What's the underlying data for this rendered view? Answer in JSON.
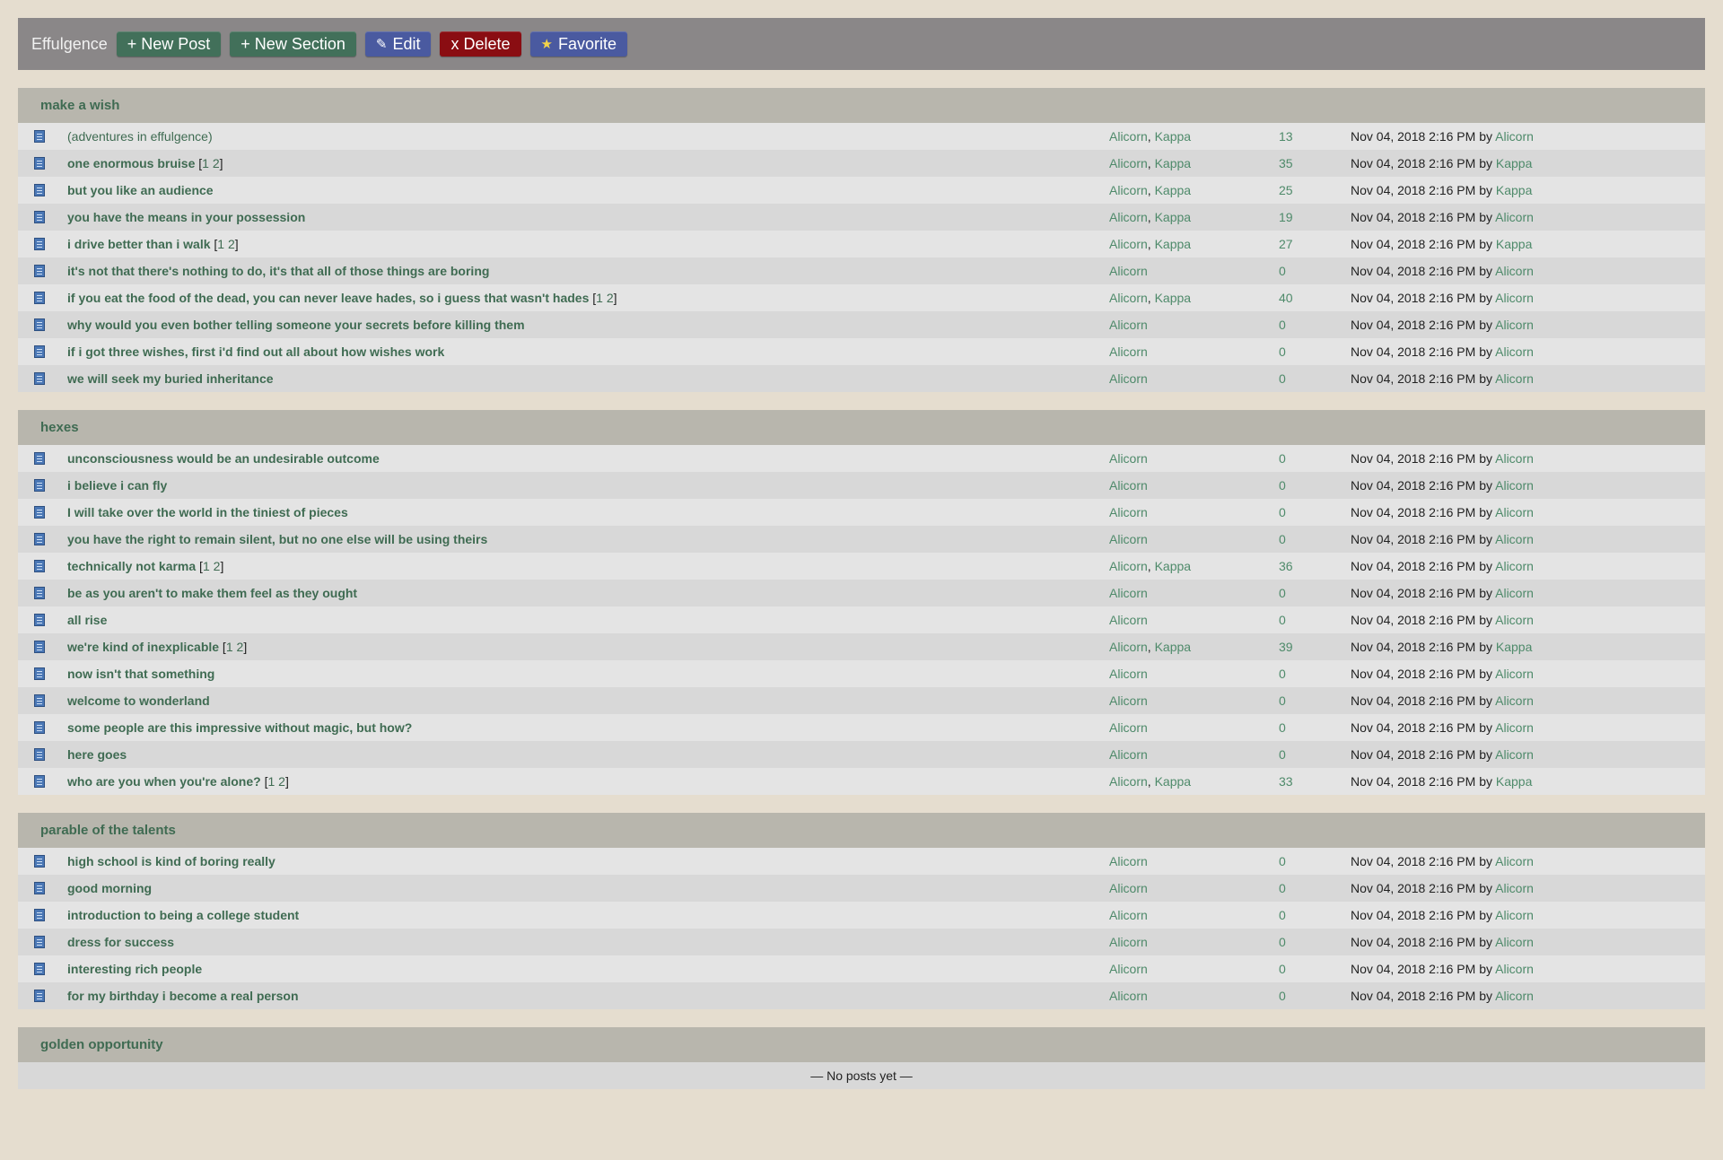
{
  "toolbar": {
    "app_title": "Effulgence",
    "buttons": [
      {
        "icon": "plus",
        "label": "+ New Post",
        "color": "#42705a"
      },
      {
        "icon": "plus",
        "label": "+ New Section",
        "color": "#42705a"
      },
      {
        "icon": "pencil-icon",
        "label": "Edit",
        "color": "#4a5aa0"
      },
      {
        "icon": "x",
        "label": "x Delete",
        "color": "#8a0d12"
      },
      {
        "icon": "star-icon",
        "label": "Favorite",
        "color": "#4a5aa0"
      }
    ]
  },
  "sections": [
    {
      "name": "make a wish",
      "posts": [
        {
          "title": "(adventures in effulgence)",
          "desc": true,
          "pages": [],
          "authors": [
            "Alicorn",
            "Kappa"
          ],
          "count": "13",
          "date": "Nov 04, 2018 2:16 PM",
          "by": "Alicorn"
        },
        {
          "title": "one enormous bruise",
          "pages": [
            "1",
            "2"
          ],
          "authors": [
            "Alicorn",
            "Kappa"
          ],
          "count": "35",
          "date": "Nov 04, 2018 2:16 PM",
          "by": "Kappa"
        },
        {
          "title": "but you like an audience",
          "pages": [],
          "authors": [
            "Alicorn",
            "Kappa"
          ],
          "count": "25",
          "date": "Nov 04, 2018 2:16 PM",
          "by": "Kappa"
        },
        {
          "title": "you have the means in your possession",
          "pages": [],
          "authors": [
            "Alicorn",
            "Kappa"
          ],
          "count": "19",
          "date": "Nov 04, 2018 2:16 PM",
          "by": "Alicorn"
        },
        {
          "title": "i drive better than i walk",
          "pages": [
            "1",
            "2"
          ],
          "authors": [
            "Alicorn",
            "Kappa"
          ],
          "count": "27",
          "date": "Nov 04, 2018 2:16 PM",
          "by": "Kappa"
        },
        {
          "title": "it's not that there's nothing to do, it's that all of those things are boring",
          "pages": [],
          "authors": [
            "Alicorn"
          ],
          "count": "0",
          "date": "Nov 04, 2018 2:16 PM",
          "by": "Alicorn"
        },
        {
          "title": "if you eat the food of the dead, you can never leave hades, so i guess that wasn't hades",
          "pages": [
            "1",
            "2"
          ],
          "authors": [
            "Alicorn",
            "Kappa"
          ],
          "count": "40",
          "date": "Nov 04, 2018 2:16 PM",
          "by": "Alicorn"
        },
        {
          "title": "why would you even bother telling someone your secrets before killing them",
          "pages": [],
          "authors": [
            "Alicorn"
          ],
          "count": "0",
          "date": "Nov 04, 2018 2:16 PM",
          "by": "Alicorn"
        },
        {
          "title": "if i got three wishes, first i'd find out all about how wishes work",
          "pages": [],
          "authors": [
            "Alicorn"
          ],
          "count": "0",
          "date": "Nov 04, 2018 2:16 PM",
          "by": "Alicorn"
        },
        {
          "title": "we will seek my buried inheritance",
          "pages": [],
          "authors": [
            "Alicorn"
          ],
          "count": "0",
          "date": "Nov 04, 2018 2:16 PM",
          "by": "Alicorn"
        }
      ]
    },
    {
      "name": "hexes",
      "posts": [
        {
          "title": "unconsciousness would be an undesirable outcome",
          "pages": [],
          "authors": [
            "Alicorn"
          ],
          "count": "0",
          "date": "Nov 04, 2018 2:16 PM",
          "by": "Alicorn"
        },
        {
          "title": "i believe i can fly",
          "pages": [],
          "authors": [
            "Alicorn"
          ],
          "count": "0",
          "date": "Nov 04, 2018 2:16 PM",
          "by": "Alicorn"
        },
        {
          "title": "I will take over the world in the tiniest of pieces",
          "pages": [],
          "authors": [
            "Alicorn"
          ],
          "count": "0",
          "date": "Nov 04, 2018 2:16 PM",
          "by": "Alicorn"
        },
        {
          "title": "you have the right to remain silent, but no one else will be using theirs",
          "pages": [],
          "authors": [
            "Alicorn"
          ],
          "count": "0",
          "date": "Nov 04, 2018 2:16 PM",
          "by": "Alicorn"
        },
        {
          "title": "technically not karma",
          "pages": [
            "1",
            "2"
          ],
          "authors": [
            "Alicorn",
            "Kappa"
          ],
          "count": "36",
          "date": "Nov 04, 2018 2:16 PM",
          "by": "Alicorn"
        },
        {
          "title": "be as you aren't to make them feel as they ought",
          "pages": [],
          "authors": [
            "Alicorn"
          ],
          "count": "0",
          "date": "Nov 04, 2018 2:16 PM",
          "by": "Alicorn"
        },
        {
          "title": "all rise",
          "pages": [],
          "authors": [
            "Alicorn"
          ],
          "count": "0",
          "date": "Nov 04, 2018 2:16 PM",
          "by": "Alicorn"
        },
        {
          "title": "we're kind of inexplicable",
          "pages": [
            "1",
            "2"
          ],
          "authors": [
            "Alicorn",
            "Kappa"
          ],
          "count": "39",
          "date": "Nov 04, 2018 2:16 PM",
          "by": "Kappa"
        },
        {
          "title": "now isn't that something",
          "pages": [],
          "authors": [
            "Alicorn"
          ],
          "count": "0",
          "date": "Nov 04, 2018 2:16 PM",
          "by": "Alicorn"
        },
        {
          "title": "welcome to wonderland",
          "pages": [],
          "authors": [
            "Alicorn"
          ],
          "count": "0",
          "date": "Nov 04, 2018 2:16 PM",
          "by": "Alicorn"
        },
        {
          "title": "some people are this impressive without magic, but how?",
          "pages": [],
          "authors": [
            "Alicorn"
          ],
          "count": "0",
          "date": "Nov 04, 2018 2:16 PM",
          "by": "Alicorn"
        },
        {
          "title": "here goes",
          "pages": [],
          "authors": [
            "Alicorn"
          ],
          "count": "0",
          "date": "Nov 04, 2018 2:16 PM",
          "by": "Alicorn"
        },
        {
          "title": "who are you when you're alone?",
          "pages": [
            "1",
            "2"
          ],
          "authors": [
            "Alicorn",
            "Kappa"
          ],
          "count": "33",
          "date": "Nov 04, 2018 2:16 PM",
          "by": "Kappa"
        }
      ]
    },
    {
      "name": "parable of the talents",
      "posts": [
        {
          "title": "high school is kind of boring really",
          "pages": [],
          "authors": [
            "Alicorn"
          ],
          "count": "0",
          "date": "Nov 04, 2018 2:16 PM",
          "by": "Alicorn"
        },
        {
          "title": "good morning",
          "pages": [],
          "authors": [
            "Alicorn"
          ],
          "count": "0",
          "date": "Nov 04, 2018 2:16 PM",
          "by": "Alicorn"
        },
        {
          "title": "introduction to being a college student",
          "pages": [],
          "authors": [
            "Alicorn"
          ],
          "count": "0",
          "date": "Nov 04, 2018 2:16 PM",
          "by": "Alicorn"
        },
        {
          "title": "dress for success",
          "pages": [],
          "authors": [
            "Alicorn"
          ],
          "count": "0",
          "date": "Nov 04, 2018 2:16 PM",
          "by": "Alicorn"
        },
        {
          "title": "interesting rich people",
          "pages": [],
          "authors": [
            "Alicorn"
          ],
          "count": "0",
          "date": "Nov 04, 2018 2:16 PM",
          "by": "Alicorn"
        },
        {
          "title": "for my birthday i become a real person",
          "pages": [],
          "authors": [
            "Alicorn"
          ],
          "count": "0",
          "date": "Nov 04, 2018 2:16 PM",
          "by": "Alicorn"
        }
      ]
    },
    {
      "name": "golden opportunity",
      "posts": [],
      "empty_text": "— No posts yet —"
    }
  ],
  "by_word": "by"
}
